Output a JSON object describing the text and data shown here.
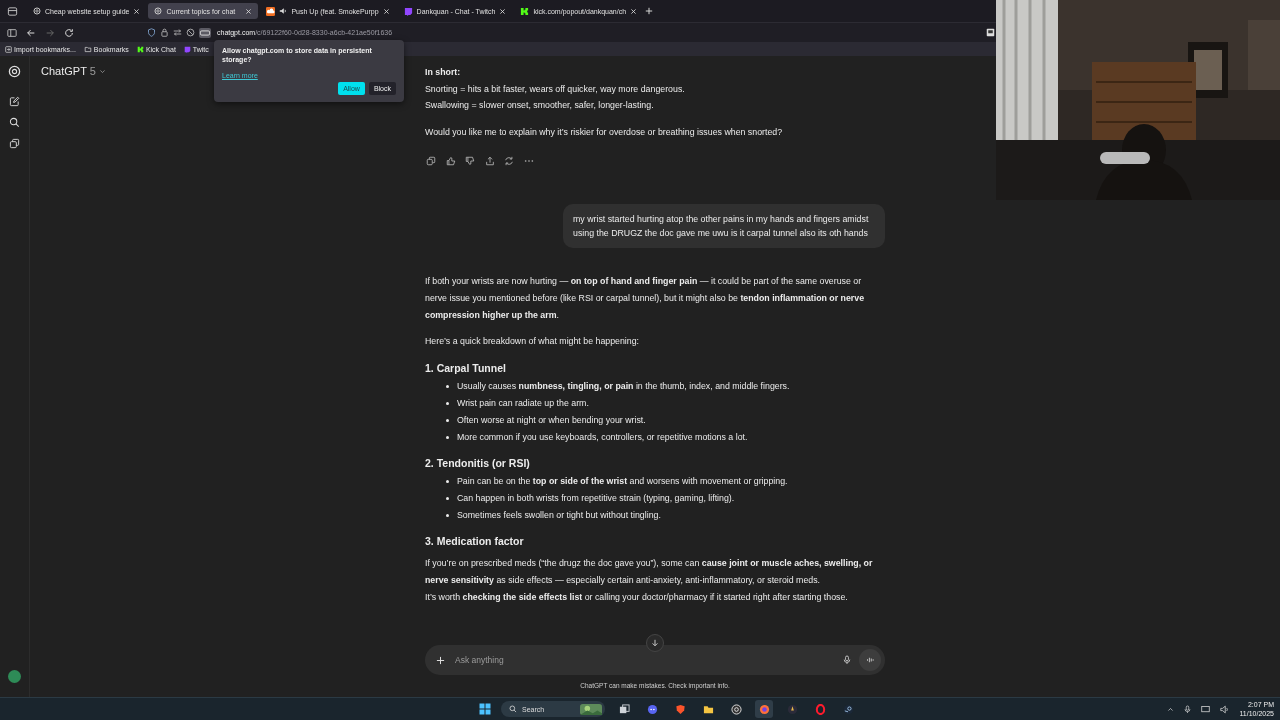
{
  "browser": {
    "tabs": [
      {
        "title": "Cheap website setup guide",
        "kind": "chatgpt",
        "selected": false,
        "audio": false
      },
      {
        "title": "Current topics for chat",
        "kind": "chatgpt",
        "selected": true,
        "audio": false
      },
      {
        "title": "Push Up (feat. SmokePurpp",
        "kind": "soundcloud",
        "selected": false,
        "audio": true
      },
      {
        "title": "Dankquan - Chat - Twitch",
        "kind": "twitch",
        "selected": false,
        "audio": false
      },
      {
        "title": "kick.com/popout/dankquan/ch",
        "kind": "kick",
        "selected": false,
        "audio": false
      }
    ],
    "address": {
      "host": "chatgpt.com",
      "path": "/c/69122f60-0d28-8330-a6cb-421ae50f1636"
    },
    "bookmarks": [
      {
        "label": "Import bookmarks...",
        "kind": "import"
      },
      {
        "label": "Bookmarks",
        "kind": "folder"
      },
      {
        "label": "Kick Chat",
        "kind": "kick"
      },
      {
        "label": "Twitc",
        "kind": "twitch"
      }
    ],
    "permission_popup": {
      "message": "Allow chatgpt.com to store data in persistent storage?",
      "link": "Learn more",
      "buttons": [
        "Allow",
        "Block"
      ]
    }
  },
  "header": {
    "model": "ChatGPT",
    "version": "5"
  },
  "conversation": {
    "previous_answer": {
      "heading": "In short:",
      "lines": [
        "Snorting = hits a bit faster, wears off quicker, way more dangerous.",
        "Swallowing = slower onset, smoother, safer, longer-lasting."
      ],
      "question": "Would you like me to explain why it’s riskier for overdose or breathing issues when snorted?"
    },
    "user_message": "my wrist started hurting atop the other pains in my hands and fingers amidst using the DRUGZ the doc gave me uwu is it carpal tunnel also its oth hands",
    "answer": {
      "intro": "If both your wrists are now hurting — **on top of hand and finger pain** — it could be part of the same overuse or nerve issue you mentioned before (like RSI or carpal tunnel), but it might also be **tendon inflammation or nerve compression higher up the arm**.",
      "lead": "Here’s a quick breakdown of what might be happening:",
      "sections": [
        {
          "heading": "1. Carpal Tunnel",
          "bullets": [
            "Usually causes **numbness, tingling, or pain** in the thumb, index, and middle fingers.",
            "Wrist pain can radiate up the arm.",
            "Often worse at night or when bending your wrist.",
            "More common if you use keyboards, controllers, or repetitive motions a lot."
          ]
        },
        {
          "heading": "2. Tendonitis (or RSI)",
          "bullets": [
            "Pain can be on the **top or side of the wrist** and worsens with movement or gripping.",
            "Can happen in both wrists from repetitive strain (typing, gaming, lifting).",
            "Sometimes feels swollen or tight but without tingling."
          ]
        },
        {
          "heading": "3. Medication factor",
          "paragraphs": [
            "If you’re on prescribed meds (“the drugz the doc gave you”), some can **cause joint or muscle aches, swelling, or nerve sensitivity** as side effects — especially certain anti-anxiety, anti-inflammatory, or steroid meds.",
            "It’s worth **checking the side effects list** or calling your doctor/pharmacy if it started right after starting those."
          ]
        }
      ]
    }
  },
  "composer": {
    "placeholder": "Ask anything"
  },
  "disclaimer": "ChatGPT can make mistakes. Check important info.",
  "taskbar": {
    "search_placeholder": "Search",
    "apps": [
      {
        "kind": "taskview",
        "selected": false
      },
      {
        "kind": "discord",
        "selected": false
      },
      {
        "kind": "brave",
        "selected": false
      },
      {
        "kind": "folder",
        "selected": false
      },
      {
        "kind": "obs",
        "selected": false
      },
      {
        "kind": "firefox",
        "selected": true
      },
      {
        "kind": "rocket",
        "selected": false
      },
      {
        "kind": "opera",
        "selected": false
      },
      {
        "kind": "steam",
        "selected": false
      }
    ],
    "time": "2:07 PM",
    "date": "11/10/2025"
  }
}
